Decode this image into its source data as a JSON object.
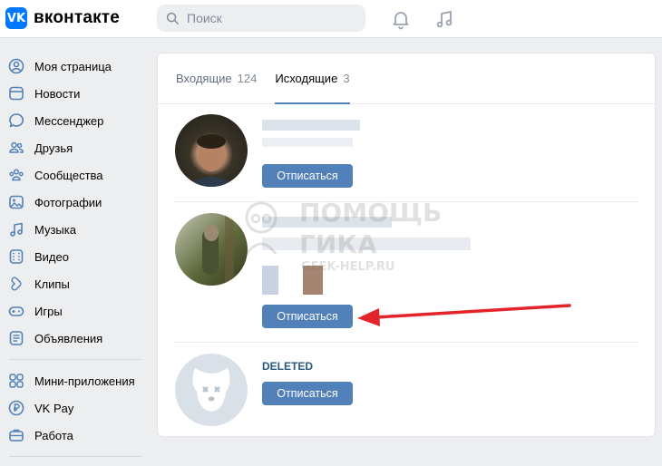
{
  "app": {
    "name": "вконтакте",
    "logo_glyph": "VK"
  },
  "search": {
    "placeholder": "Поиск"
  },
  "sidebar": {
    "items": [
      {
        "label": "Моя страница",
        "icon": "user-circle-icon"
      },
      {
        "label": "Новости",
        "icon": "news-icon"
      },
      {
        "label": "Мессенджер",
        "icon": "message-icon"
      },
      {
        "label": "Друзья",
        "icon": "friends-icon"
      },
      {
        "label": "Сообщества",
        "icon": "communities-icon"
      },
      {
        "label": "Фотографии",
        "icon": "photo-icon"
      },
      {
        "label": "Музыка",
        "icon": "music-icon"
      },
      {
        "label": "Видео",
        "icon": "video-icon"
      },
      {
        "label": "Клипы",
        "icon": "clips-icon"
      },
      {
        "label": "Игры",
        "icon": "gamepad-icon"
      },
      {
        "label": "Объявления",
        "icon": "ads-icon"
      }
    ],
    "items2": [
      {
        "label": "Мини-приложения",
        "icon": "apps-icon"
      },
      {
        "label": "VK Pay",
        "icon": "vkpay-icon"
      },
      {
        "label": "Работа",
        "icon": "work-icon"
      }
    ]
  },
  "tabs": [
    {
      "label": "Входящие",
      "count": "124"
    },
    {
      "label": "Исходящие",
      "count": "3",
      "active": true
    }
  ],
  "requests": [
    {
      "button": "Отписаться",
      "name": ""
    },
    {
      "button": "Отписаться",
      "name": ""
    },
    {
      "button": "Отписаться",
      "name": "DELETED"
    }
  ],
  "watermark": {
    "line1": "ПОМОЩЬ",
    "line2": "ГИКА",
    "line3": "GEEK-HELP.RU"
  },
  "colors": {
    "accent": "#5181b8",
    "logo": "#0077ff",
    "arrow": "#e3242b"
  }
}
